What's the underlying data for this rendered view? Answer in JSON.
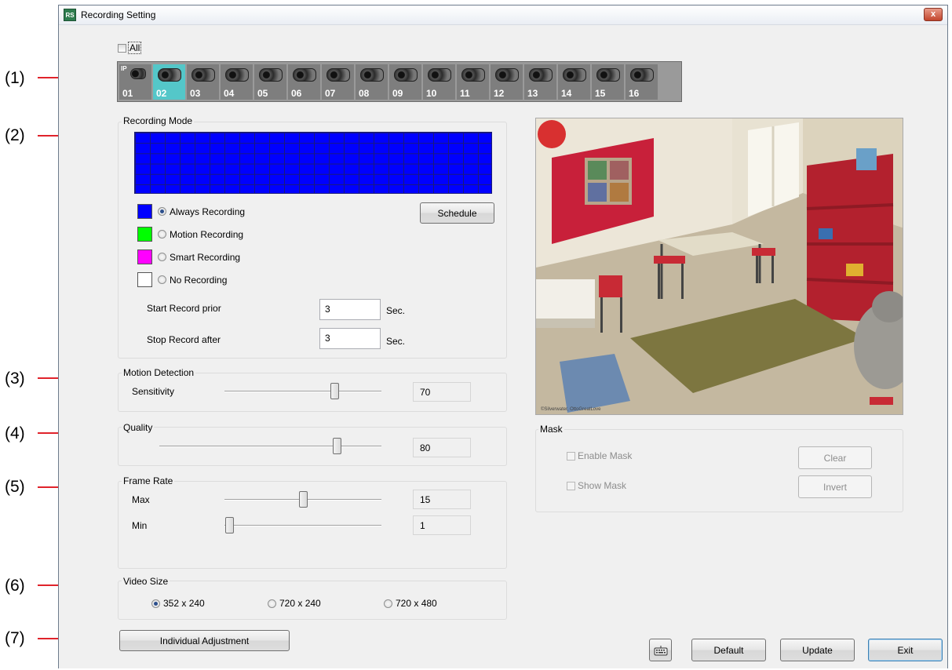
{
  "callouts": [
    "(1)",
    "(2)",
    "(3)",
    "(4)",
    "(5)",
    "(6)",
    "(7)"
  ],
  "window": {
    "title": "Recording Setting",
    "close_glyph": "x",
    "app_icon": "RS"
  },
  "cameras": {
    "all_label": "All",
    "ip_tag": "IP",
    "selected": "02",
    "items": [
      "01",
      "02",
      "03",
      "04",
      "05",
      "06",
      "07",
      "08",
      "09",
      "10",
      "11",
      "12",
      "13",
      "14",
      "15",
      "16"
    ]
  },
  "recording_mode": {
    "title": "Recording Mode",
    "grid_color": "#0000ff",
    "options": [
      {
        "label": "Always Recording",
        "color": "#0000ff",
        "selected": true
      },
      {
        "label": "Motion Recording",
        "color": "#00ff00",
        "selected": false
      },
      {
        "label": "Smart Recording",
        "color": "#ff00ff",
        "selected": false
      },
      {
        "label": "No Recording",
        "color": "#ffffff",
        "selected": false
      }
    ],
    "schedule_button": "Schedule",
    "start_prior_label": "Start Record prior",
    "start_prior_value": "3",
    "stop_after_label": "Stop Record after",
    "stop_after_value": "3",
    "unit": "Sec."
  },
  "motion_detection": {
    "title": "Motion Detection",
    "sensitivity_label": "Sensitivity",
    "value": "70",
    "level": 0.7
  },
  "quality": {
    "title": "Quality",
    "value": "80",
    "level": 0.8
  },
  "frame_rate": {
    "title": "Frame Rate",
    "max_label": "Max",
    "max_value": "15",
    "max_level": 0.5,
    "min_label": "Min",
    "min_value": "1",
    "min_level": 0.03
  },
  "video_size": {
    "title": "Video Size",
    "options": [
      "352 x 240",
      "720 x 240",
      "720 x 480"
    ],
    "selected": "352 x 240"
  },
  "individual_adjustment_button": "Individual Adjustment",
  "mask": {
    "title": "Mask",
    "enable_label": "Enable Mask",
    "show_label": "Show Mask",
    "clear_button": "Clear",
    "invert_button": "Invert"
  },
  "footer": {
    "default_button": "Default",
    "update_button": "Update",
    "exit_button": "Exit",
    "keyboard_icon": "keyboard-icon"
  },
  "colors": {
    "callout_line": "#e0232b",
    "selected_camera": "#54c7c9"
  }
}
